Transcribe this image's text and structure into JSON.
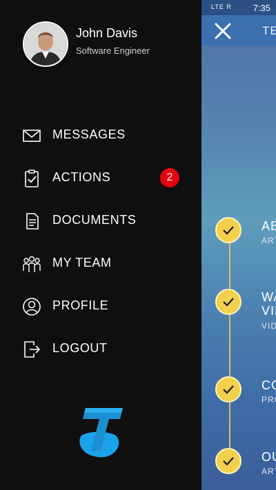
{
  "status_bar": {
    "indicators": "LTE R",
    "time": "7:35"
  },
  "content": {
    "title": "TE",
    "timeline": [
      {
        "title": "AB",
        "subtitle": "ART"
      },
      {
        "title": "WA VID",
        "title_line1": "WA",
        "title_line2": "VID",
        "subtitle": "VID"
      },
      {
        "title": "CO",
        "subtitle": "PRO"
      },
      {
        "title": "OU",
        "subtitle": "ART"
      }
    ]
  },
  "drawer": {
    "user": {
      "name": "John Davis",
      "role": "Software Engineer"
    },
    "menu": [
      {
        "label": "MESSAGES",
        "icon": "envelope-icon"
      },
      {
        "label": "ACTIONS",
        "icon": "clipboard-check-icon",
        "badge": "2"
      },
      {
        "label": "DOCUMENTS",
        "icon": "document-icon"
      },
      {
        "label": "MY TEAM",
        "icon": "team-icon"
      },
      {
        "label": "PROFILE",
        "icon": "profile-icon"
      },
      {
        "label": "LOGOUT",
        "icon": "logout-icon"
      }
    ],
    "logo": "telstra-logo"
  },
  "colors": {
    "drawer_bg": "#0f0f0f",
    "badge": "#e5000f",
    "accent_blue": "#3b6fb0",
    "timeline_check": "#f2cf4c",
    "logo_blue": "#1aa3e8"
  }
}
